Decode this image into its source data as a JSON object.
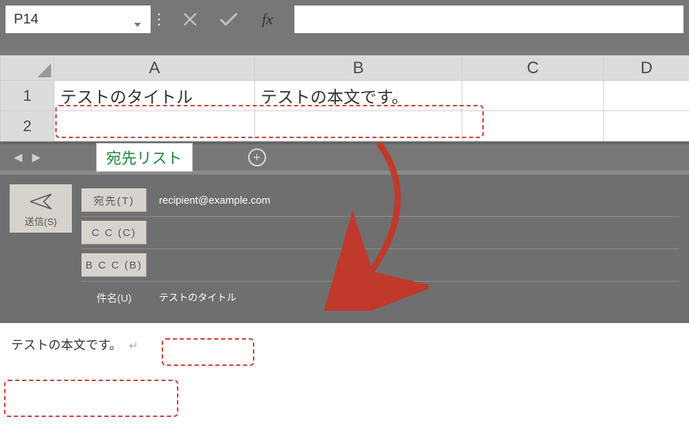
{
  "formula_bar": {
    "name_box_value": "P14",
    "cancel_icon": "×",
    "confirm_icon": "✓",
    "fx_label": "fx"
  },
  "grid": {
    "columns": [
      "A",
      "B",
      "C",
      "D"
    ],
    "rows": [
      {
        "num": "1",
        "cells": [
          "テストのタイトル",
          "テストの本文です。",
          "",
          ""
        ]
      },
      {
        "num": "2",
        "cells": [
          "",
          "",
          "",
          ""
        ]
      }
    ]
  },
  "tabs": {
    "active_tab": "宛先リスト",
    "add_symbol": "+",
    "prev": "◀",
    "next": "▶"
  },
  "mail": {
    "send_label": "送信(S)",
    "to_label": "宛先(T)",
    "cc_label": "C C (C)",
    "bcc_label": "B C C (B)",
    "subject_label": "件名(U)",
    "to_value": "recipient@example.com",
    "cc_value": "",
    "bcc_value": "",
    "subject_value": "テストのタイトル",
    "body_value": "テストの本文です。",
    "return_glyph": "↵"
  }
}
